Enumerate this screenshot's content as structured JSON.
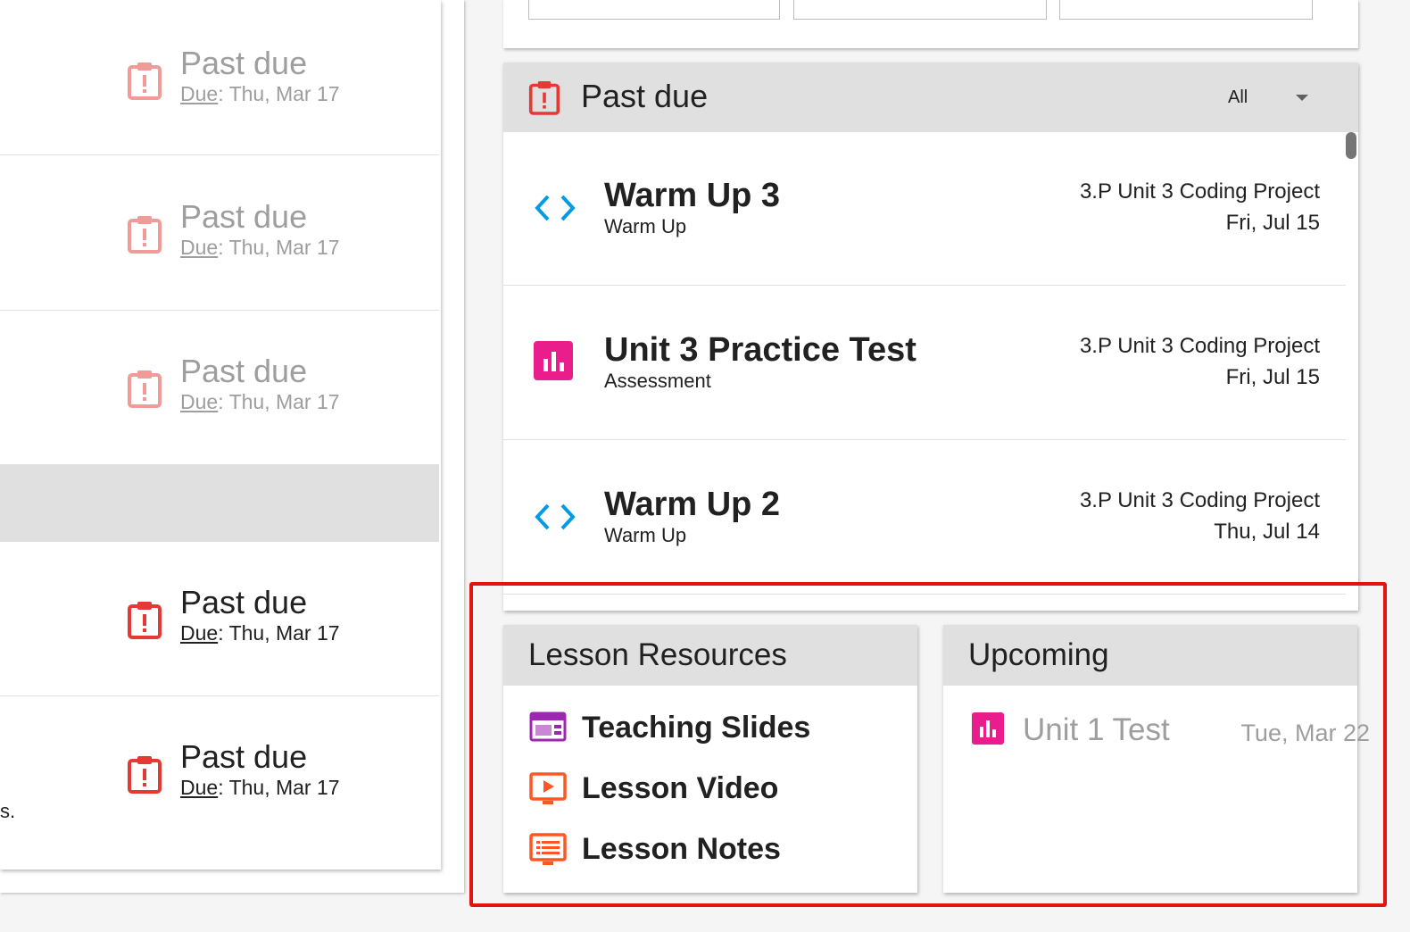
{
  "colors": {
    "past_due_red": "#e53935",
    "code_blue": "#039be5",
    "assessment_pink": "#e91e8c",
    "slides_purple": "#9c27b0",
    "video_orange": "#ff5722",
    "highlight_red": "#e41313"
  },
  "left_list": {
    "items": [
      {
        "title": "Past due",
        "due_label": "Due",
        "due_rest": ": Thu, Mar 17",
        "icon": "clipboard-alert-icon",
        "faded": true
      },
      {
        "title": "Past due",
        "due_label": "Due",
        "due_rest": ": Thu, Mar 17",
        "icon": "clipboard-alert-icon",
        "faded": true
      },
      {
        "title": "Past due",
        "due_label": "Due",
        "due_rest": ": Thu, Mar 17",
        "icon": "clipboard-alert-icon",
        "faded": true
      },
      {
        "title": "Past due",
        "due_label": "Due",
        "due_rest": ": Thu, Mar 17",
        "icon": "clipboard-alert-icon",
        "faded": false
      },
      {
        "title": "Past due",
        "due_label": "Due",
        "due_rest": ": Thu, Mar 17",
        "icon": "clipboard-alert-icon",
        "faded": false
      }
    ],
    "fragment_text": "s."
  },
  "past_due_card": {
    "title": "Past due",
    "icon": "clipboard-alert-icon",
    "filter": {
      "selected": "All"
    },
    "rows": [
      {
        "name": "Warm Up 3",
        "type": "Warm Up",
        "course": "3.P Unit 3 Coding Project",
        "date": "Fri, Jul 15",
        "icon": "code-brackets-icon"
      },
      {
        "name": "Unit 3 Practice Test",
        "type": "Assessment",
        "course": "3.P Unit 3 Coding Project",
        "date": "Fri, Jul 15",
        "icon": "bar-chart-icon"
      },
      {
        "name": "Warm Up 2",
        "type": "Warm Up",
        "course": "3.P Unit 3 Coding Project",
        "date": "Thu, Jul 14",
        "icon": "code-brackets-icon"
      }
    ]
  },
  "lesson_resources": {
    "title": "Lesson Resources",
    "items": [
      {
        "label": "Teaching Slides",
        "icon": "slides-icon"
      },
      {
        "label": "Lesson Video",
        "icon": "video-icon"
      },
      {
        "label": "Lesson Notes",
        "icon": "notes-icon"
      }
    ]
  },
  "upcoming": {
    "title": "Upcoming",
    "items": [
      {
        "label": "Unit 1 Test",
        "date": "Tue, Mar 22",
        "icon": "bar-chart-icon"
      }
    ]
  }
}
